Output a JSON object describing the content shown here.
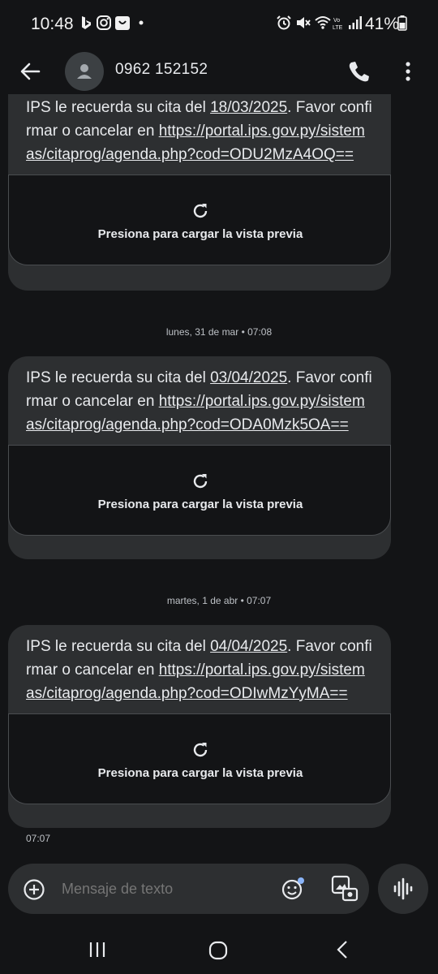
{
  "status_bar": {
    "time": "10:48",
    "battery": "41%",
    "left_icons": [
      "bing-icon",
      "instagram-icon",
      "shopping-bag-icon",
      "dot-icon"
    ],
    "right_icons": [
      "alarm-icon",
      "mute-icon",
      "wifi-icon",
      "volte-icon",
      "signal-icon",
      "battery-icon"
    ]
  },
  "header": {
    "contact": "0962 152152"
  },
  "messages": [
    {
      "text_prefix": "IPS le recuerda su cita del ",
      "date": "18/03/2025",
      "text_suffix": ". Favor confirmar o cancelar en ",
      "url": "https://portal.ips.gov.py/sistemas/citaprog/agenda.php?cod=ODU2MzA4OQ==",
      "preview_label": "Presiona para cargar la vista previa"
    },
    {
      "timestamp": "lunes, 31 de mar • 07:08",
      "text_prefix": "IPS le recuerda su cita del ",
      "date": "03/04/2025",
      "text_suffix": ". Favor confirmar o cancelar en ",
      "url": "https://portal.ips.gov.py/sistemas/citaprog/agenda.php?cod=ODA0Mzk5OA==",
      "preview_label": "Presiona para cargar la vista previa"
    },
    {
      "timestamp": "martes, 1 de abr • 07:07",
      "text_prefix": "IPS le recuerda su cita del ",
      "date": "04/04/2025",
      "text_suffix": ". Favor confirmar o cancelar en ",
      "url": "https://portal.ips.gov.py/sistemas/citaprog/agenda.php?cod=ODIwMzYyMA==",
      "preview_label": "Presiona para cargar la vista previa",
      "sent_time": "07:07"
    }
  ],
  "compose": {
    "placeholder": "Mensaje de texto"
  },
  "colors": {
    "background": "#131416",
    "bubble": "#2d2f31",
    "accent_dot": "#8ab4f8"
  }
}
